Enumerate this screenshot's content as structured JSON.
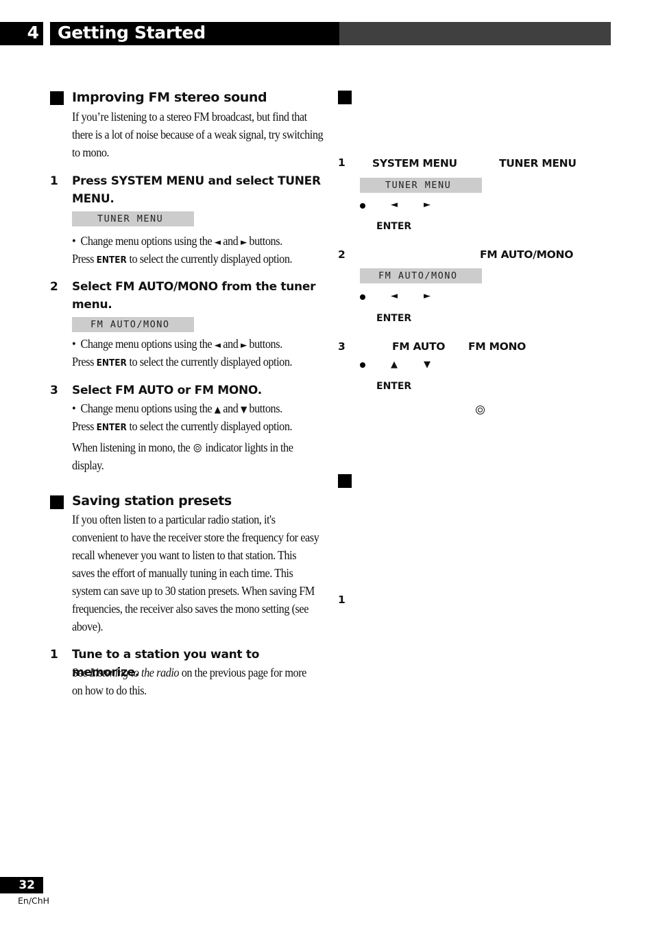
{
  "header": {
    "chapter_number": "4",
    "chapter_title": "Getting Started"
  },
  "left": {
    "section1": {
      "title": "Improving FM stereo sound",
      "intro": "If you’re listening to a stereo FM broadcast, but find that there is a lot of noise because of a weak signal, try switching to mono.",
      "steps": [
        {
          "number": "1",
          "title": "Press SYSTEM MENU and select TUNER MENU.",
          "display": "TUNER MENU",
          "bullet_pre": "Change menu options using the",
          "icon_a": "◄",
          "and": "and",
          "icon_b": "►",
          "bullet_post": "buttons.",
          "press": "Press",
          "enter": "ENTER",
          "press_post": "to select the currently displayed option."
        },
        {
          "number": "2",
          "title": "Select FM AUTO/MONO from the tuner menu.",
          "display": "FM AUTO/MONO",
          "bullet_pre": "Change menu options using the",
          "icon_a": "◄",
          "and": "and",
          "icon_b": "►",
          "bullet_post": "buttons.",
          "press": "Press",
          "enter": "ENTER",
          "press_post": "to select the currently displayed option."
        },
        {
          "number": "3",
          "title": "Select FM AUTO or FM MONO.",
          "bullet_pre": "Change menu options using the",
          "icon_a": "▲",
          "and": "and",
          "icon_b": "▼",
          "bullet_post": "buttons.",
          "press": "Press",
          "enter": "ENTER",
          "press_post": "to select the currently displayed option.",
          "note_pre": "When listening in mono, the",
          "note_post": "indicator lights in the display."
        }
      ]
    },
    "section2": {
      "title": "Saving station presets",
      "intro": "If you often listen to a particular radio station, it's convenient to have the receiver store the frequency for easy recall whenever you want to listen to that station. This saves the effort of manually tuning in each time. This system can save up to 30 station presets. When saving FM frequencies, the receiver also saves the mono setting (see above).",
      "steps": [
        {
          "number": "1",
          "title": "Tune to a station you want to memorize.",
          "see": "See",
          "link": "Listening to the radio",
          "rest": "on the previous page for more on how to do this."
        }
      ]
    }
  },
  "right": {
    "steps": [
      {
        "number": "1",
        "label_a": "SYSTEM MENU",
        "label_b": "TUNER MENU",
        "display": "TUNER MENU",
        "icon_a": "◄",
        "icon_b": "►",
        "enter": "ENTER"
      },
      {
        "number": "2",
        "label_a": "FM AUTO/MONO",
        "display": "FM AUTO/MONO",
        "icon_a": "◄",
        "icon_b": "►",
        "enter": "ENTER"
      },
      {
        "number": "3",
        "label_a": "FM AUTO",
        "label_b": "FM MONO",
        "icon_a": "▲",
        "icon_b": "▼",
        "enter": "ENTER"
      }
    ],
    "section2_step": "1"
  },
  "footer": {
    "page_number": "32",
    "language": "En/ChH"
  }
}
